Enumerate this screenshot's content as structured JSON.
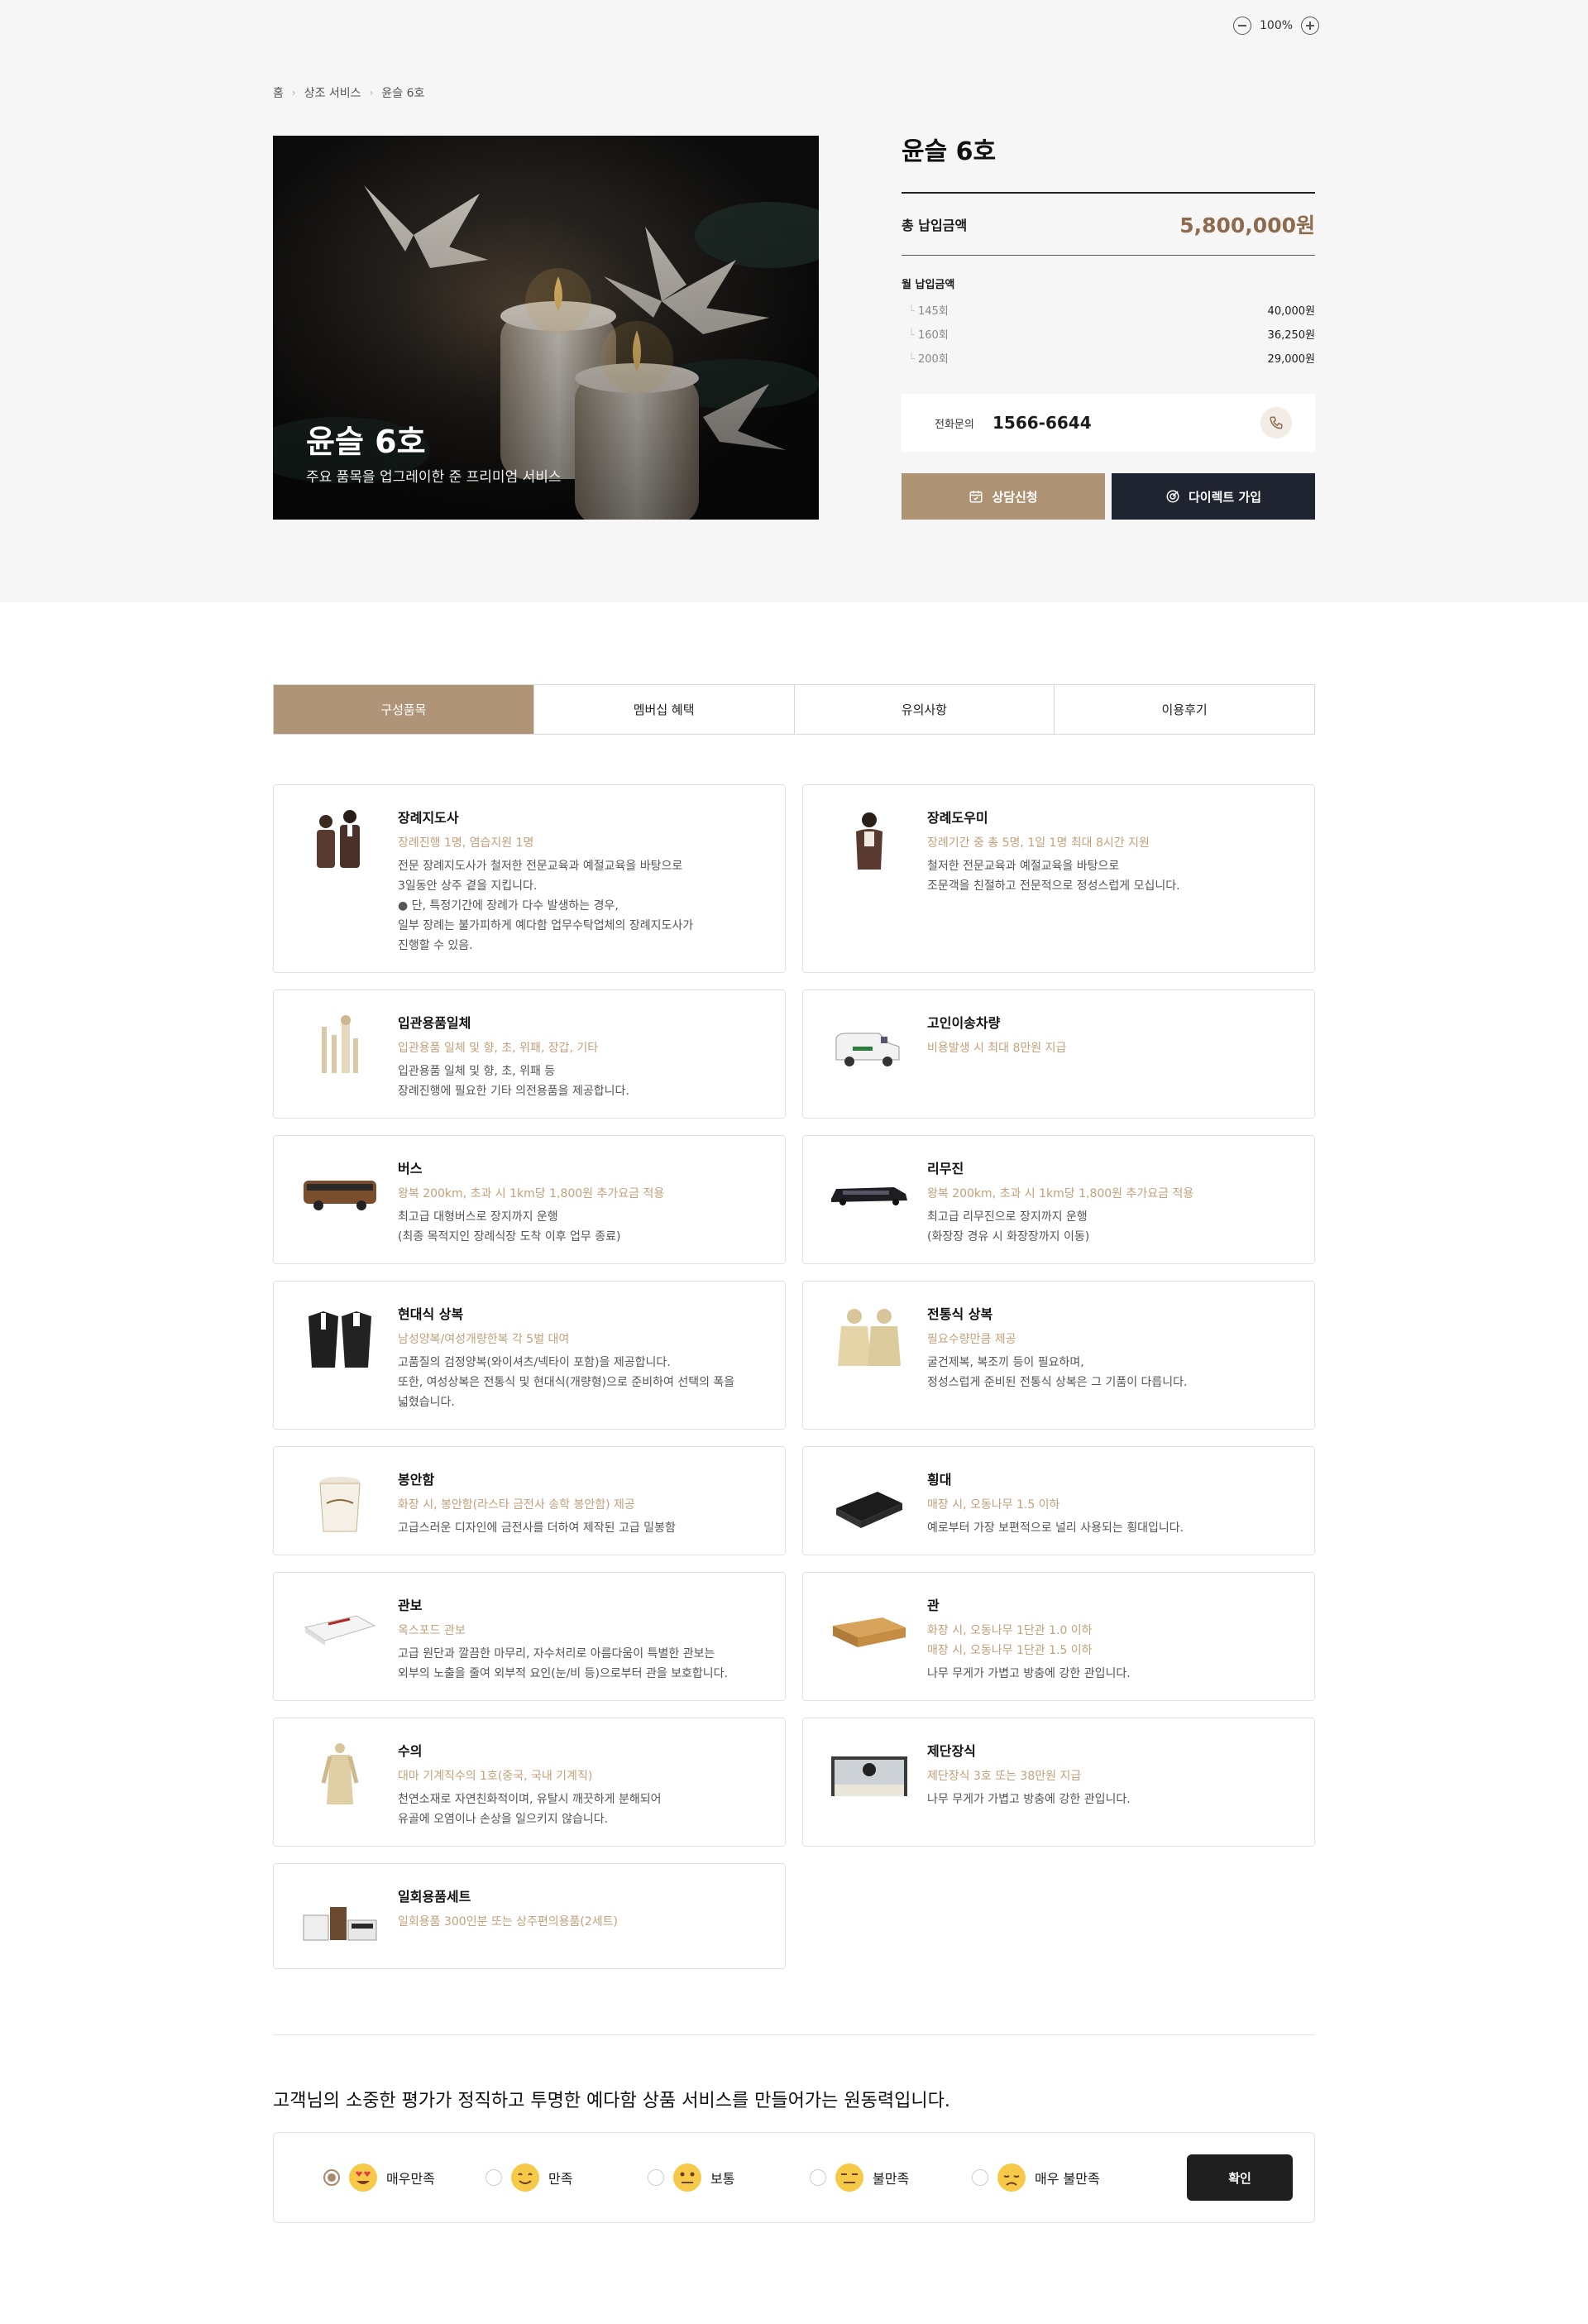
{
  "zoom": {
    "level": "100%"
  },
  "breadcrumb": [
    "홈",
    "상조 서비스",
    "윤슬 6호"
  ],
  "hero": {
    "title": "윤슬 6호",
    "subtitle": "주요 품목을 업그레이한 준 프리미엄 서비스"
  },
  "product": {
    "name": "윤슬 6호",
    "total_label": "총 납입금액",
    "total_amount": "5,800,000원",
    "monthly_label": "월 납입금액",
    "monthly": [
      {
        "count": "145회",
        "amount": "40,000원"
      },
      {
        "count": "160회",
        "amount": "36,250원"
      },
      {
        "count": "200회",
        "amount": "29,000원"
      }
    ],
    "phone_label": "전화문의",
    "phone_number": "1566-6644",
    "consult_button": "상담신청",
    "direct_button": "다이렉트 가입"
  },
  "tabs": [
    "구성품목",
    "멤버십 혜택",
    "유의사항",
    "이용후기"
  ],
  "items": [
    {
      "title": "장례지도사",
      "highlight": "장례진행 1명, 염습지원 1명",
      "desc": "전문 장례지도사가 철저한 전문교육과 예절교육을 바탕으로\n3일동안 상주 곁을 지킵니다.\n● 단, 특정기간에 장례가 다수 발생하는 경우,\n일부 장례는 불가피하게 예다함 업무수탁업체의 장례지도사가\n진행할 수 있음."
    },
    {
      "title": "장례도우미",
      "highlight": "장례기간 중 총 5명, 1일 1명 최대 8시간 지원",
      "desc": "철저한 전문교육과 예절교육을 바탕으로\n조문객을 친절하고 전문적으로 정성스럽게 모십니다."
    },
    {
      "title": "입관용품일체",
      "highlight": "입관용품 일체 및 향, 초, 위패, 장갑, 기타",
      "desc": "입관용품 일체 및 향, 초, 위패 등\n장례진행에 필요한 기타 의전용품을 제공합니다."
    },
    {
      "title": "고인이송차량",
      "highlight": "비용발생 시 최대 8만원 지급",
      "desc": ""
    },
    {
      "title": "버스",
      "highlight": "왕복 200km, 초과 시 1km당 1,800원 추가요금 적용",
      "desc": "최고급 대형버스로 장지까지 운행\n(최종 목적지인 장례식장 도착 이후 업무 종료)"
    },
    {
      "title": "리무진",
      "highlight": "왕복 200km, 초과 시 1km당 1,800원 추가요금 적용",
      "desc": "최고급 리무진으로 장지까지 운행\n(화장장 경유 시 화장장까지 이동)"
    },
    {
      "title": "현대식 상복",
      "highlight": "남성양복/여성개량한복 각 5벌 대여",
      "desc": "고품질의 검정양복(와이셔츠/넥타이 포함)을 제공합니다.\n또한, 여성상복은 전통식 및 현대식(개량형)으로 준비하여 선택의 폭을\n넓혔습니다."
    },
    {
      "title": "전통식 상복",
      "highlight": "필요수량만큼 제공",
      "desc": "굴건제복, 복조끼 등이 필요하며,\n정성스럽게 준비된 전통식 상복은 그 기품이 다릅니다."
    },
    {
      "title": "봉안함",
      "highlight": "화장 시, 봉안함(라스타 금전사 송학 봉안함) 제공",
      "desc": "고급스러운 디자인에 금전사를 더하여 제작된 고급 밀봉함"
    },
    {
      "title": "횡대",
      "highlight": "매장 시, 오동나무 1.5 이하",
      "desc": "예로부터 가장 보편적으로 널리 사용되는 횡대입니다."
    },
    {
      "title": "관보",
      "highlight": "옥스포드 관보",
      "desc": "고급 원단과 깔끔한 마무리, 자수처리로 아름다움이 특별한 관보는\n외부의 노출을 줄여 외부적 요인(눈/비 등)으로부터 관을 보호합니다."
    },
    {
      "title": "관",
      "highlight": "화장 시, 오동나무 1단관 1.0 이하\n매장 시, 오동나무 1단관 1.5 이하",
      "desc": "나무 무게가 가볍고 방충에 강한 관입니다."
    },
    {
      "title": "수의",
      "highlight": "대마 기계직수의 1호(중국, 국내 기계직)",
      "desc": "천연소재로 자연친화적이며, 유탈시 깨끗하게 분해되어\n유골에 오염이나 손상을 일으키지 않습니다."
    },
    {
      "title": "제단장식",
      "highlight": "제단장식 3호 또는 38만원 지급",
      "desc": "나무 무게가 가볍고 방충에 강한 관입니다."
    },
    {
      "title": "일회용품세트",
      "highlight": "일회용품 300인분 또는 상주편의용품(2세트)",
      "desc": ""
    }
  ],
  "survey": {
    "question": "고객님의 소중한 평가가 정직하고 투명한 예다함 상품 서비스를 만들어가는 원동력입니다.",
    "options": [
      "매우만족",
      "만족",
      "보통",
      "불만족",
      "매우 불만족"
    ],
    "selected": "매우만족",
    "confirm_label": "확인"
  },
  "colors": {
    "accent": "#b09478",
    "highlight_text": "#c4a07a",
    "dark": "#1f2430"
  }
}
